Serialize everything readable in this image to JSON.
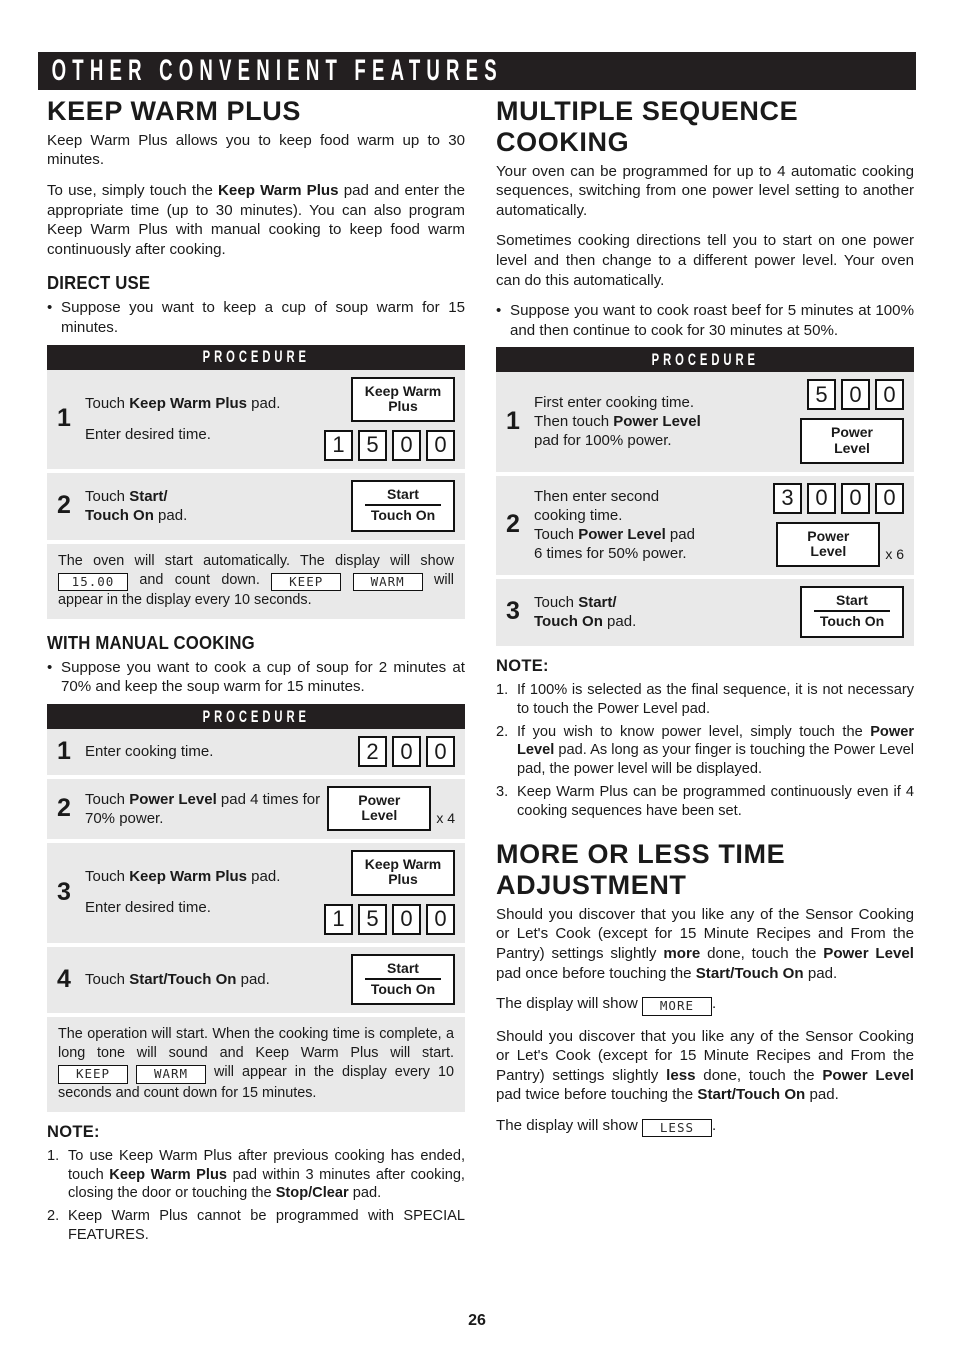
{
  "banner": {
    "title": "OTHER CONVENIENT FEATURES"
  },
  "page_number": "26",
  "labels": {
    "procedure": "PROCEDURE",
    "note": "NOTE:",
    "pad_keep_warm_plus_line1": "Keep Warm",
    "pad_keep_warm_plus_line2": "Plus",
    "pad_start": "Start",
    "pad_touch_on": "Touch On",
    "pad_power_line1": "Power",
    "pad_power_line2": "Level",
    "mult_x4": "x 4",
    "mult_x6": "x 6"
  },
  "left": {
    "heading": "KEEP WARM PLUS",
    "intro1": "Keep Warm Plus allows you to keep food warm up to 30 minutes.",
    "intro2_a": "To use, simply touch the ",
    "intro2_b": "Keep Warm Plus",
    "intro2_c": " pad and enter the appropriate time (up to 30 minutes). You can also program Keep Warm Plus with manual cooking to keep food warm continuously after cooking.",
    "direct_use": {
      "heading": "DIRECT USE",
      "bullet": "Suppose you want to keep a cup of soup warm for 15 minutes.",
      "steps": [
        {
          "num": "1",
          "text_a": "Touch ",
          "text_b": "Keep Warm Plus",
          "text_c": " pad.",
          "text_line2": "Enter desired time.",
          "digits": [
            "1",
            "5",
            "0",
            "0"
          ]
        },
        {
          "num": "2",
          "text_a": "Touch ",
          "text_b": "Start/",
          "text_c": "",
          "text_b2": "Touch On",
          "text_c2": " pad."
        }
      ],
      "result_a": "The oven will start automatically. The display will show ",
      "result_lcd_time": "15.00",
      "result_b": " and count down. ",
      "result_lcd_keep": "KEEP",
      "result_lcd_warm": "WARM",
      "result_c": " will appear in the display every 10 seconds."
    },
    "manual": {
      "heading": "WITH MANUAL COOKING",
      "bullet": "Suppose you want to cook a cup of soup for 2 minutes at 70% and keep the soup warm for 15 minutes.",
      "steps": [
        {
          "num": "1",
          "text": "Enter cooking time.",
          "digits": [
            "2",
            "0",
            "0"
          ]
        },
        {
          "num": "2",
          "text_a": "Touch ",
          "text_b": "Power Level",
          "text_c": " pad 4 times for 70% power.",
          "mult": "x 4"
        },
        {
          "num": "3",
          "text_a": "Touch ",
          "text_b": "Keep Warm Plus",
          "text_c": " pad.",
          "text_line2": "Enter desired time.",
          "digits": [
            "1",
            "5",
            "0",
            "0"
          ]
        },
        {
          "num": "4",
          "text_a": "Touch ",
          "text_b": "Start/Touch On",
          "text_c": " pad."
        }
      ],
      "result_a": "The operation will start. When the cooking time is complete, a long tone will sound and Keep Warm Plus will start. ",
      "result_lcd_keep": "KEEP",
      "result_lcd_warm": "WARM",
      "result_b": " will appear in the display every 10 seconds and count down for 15 minutes."
    },
    "notes": [
      {
        "idx": "1.",
        "a": "To use Keep Warm Plus after previous cooking has ended, touch ",
        "b": "Keep Warm Plus",
        "c": " pad within 3 minutes after cooking, closing the door or touching the ",
        "d": "Stop/Clear",
        "e": " pad."
      },
      {
        "idx": "2.",
        "a": "Keep Warm Plus cannot be programmed with SPECIAL FEATURES."
      }
    ]
  },
  "right": {
    "heading": "MULTIPLE SEQUENCE COOKING",
    "intro1": "Your oven can be programmed for up to 4 automatic cooking sequences, switching from one power level setting to another automatically.",
    "intro2": "Sometimes cooking directions tell you to start on one power level and then change to a different power level. Your oven can do this automatically.",
    "bullet": "Suppose you want to cook roast beef for 5 minutes at 100% and then continue to cook for 30 minutes at 50%.",
    "steps": [
      {
        "num": "1",
        "line1": "First enter cooking time.",
        "line2_a": "Then touch ",
        "line2_b": "Power Level",
        "line3": "pad for 100% power.",
        "digits": [
          "5",
          "0",
          "0"
        ]
      },
      {
        "num": "2",
        "line1": "Then enter second",
        "line2": "cooking time.",
        "line3_a": "Touch ",
        "line3_b": "Power Level",
        "line3_c": " pad",
        "line4": "6 times for 50% power.",
        "digits": [
          "3",
          "0",
          "0",
          "0"
        ],
        "mult": "x 6"
      },
      {
        "num": "3",
        "text_a": "Touch ",
        "text_b": "Start/",
        "text_b2": "Touch On",
        "text_c2": " pad."
      }
    ],
    "notes": [
      {
        "idx": "1.",
        "a": "If 100% is selected as the final sequence, it is not necessary to touch the Power Level pad."
      },
      {
        "idx": "2.",
        "a": "If you wish to know power level, simply touch the ",
        "b": "Power Level",
        "c": " pad. As long as your finger is touching the Power Level pad, the power level will be displayed."
      },
      {
        "idx": "3.",
        "a": "Keep Warm Plus can be programmed continuously even if 4 cooking sequences have been set."
      }
    ],
    "more_less": {
      "heading": "MORE OR LESS TIME ADJUSTMENT",
      "para_more_a": "Should you discover that you like any of the Sensor Cooking or Let's Cook (except for 15 Minute Recipes and From the Pantry) settings slightly ",
      "para_more_b": "more",
      "para_more_c": " done, touch the ",
      "para_more_d": "Power Level",
      "para_more_e": " pad once before touching the ",
      "para_more_f": "Start/Touch On",
      "para_more_g": " pad.",
      "show_more_a": "The display will show ",
      "show_more_lcd": "MORE",
      "show_more_b": ".",
      "para_less_a": "Should you discover that you like any of the Sensor Cooking or Let's Cook (except for 15 Minute Recipes and From the Pantry) settings slightly ",
      "para_less_b": "less",
      "para_less_c": " done, touch the ",
      "para_less_d": "Power Level",
      "para_less_e": " pad twice before touching the ",
      "para_less_f": "Start/Touch On",
      "para_less_g": " pad.",
      "show_less_a": "The display will show ",
      "show_less_lcd": "LESS",
      "show_less_b": "."
    }
  }
}
